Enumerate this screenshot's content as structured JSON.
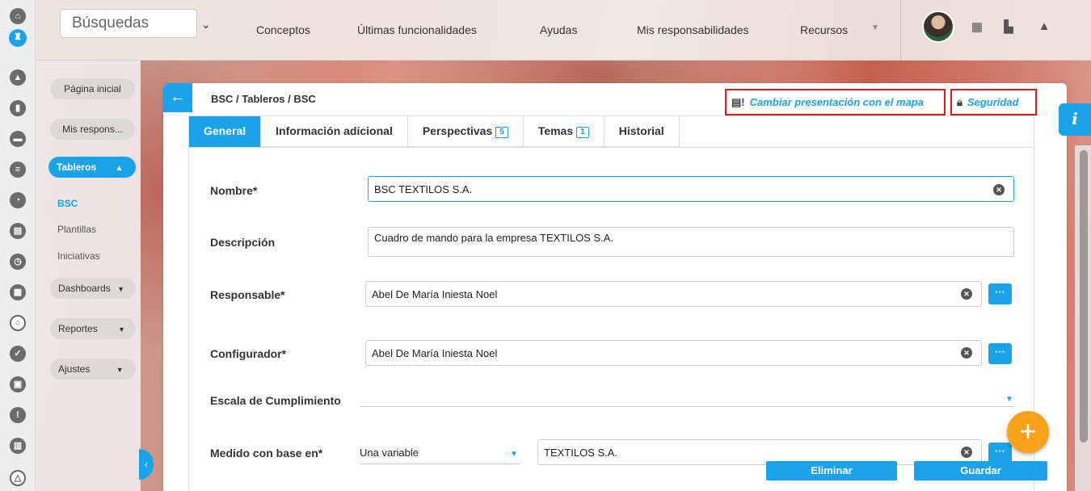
{
  "rail": {
    "icons": [
      "home-icon",
      "tower-icon",
      "user-up-icon",
      "chart-icon",
      "presentation-icon",
      "list-icon",
      "pie-icon",
      "book-icon",
      "clock-icon",
      "document-icon",
      "circle-dash-icon",
      "check-icon",
      "briefcase-icon",
      "warning-icon",
      "calendar-icon",
      "network-icon"
    ]
  },
  "topbar": {
    "search_label": "Búsquedas",
    "nav": [
      "Conceptos",
      "Últimas funcionalidades",
      "Ayudas",
      "Mis responsabilidades",
      "Recursos"
    ]
  },
  "sidebar": {
    "home": "Página inicial",
    "mine": "Mis respons...",
    "boards": "Tableros",
    "bsc": "BSC",
    "templates": "Plantillas",
    "initiatives": "Iniciativas",
    "dashboards": "Dashboards",
    "reports": "Reportes",
    "settings": "Ajustes"
  },
  "header": {
    "breadcrumb": "BSC / Tableros / BSC",
    "map_action": "Cambiar presentación con el mapa",
    "security_action": "Seguridad"
  },
  "tabs": {
    "general": "General",
    "extra": "Información adicional",
    "perspectives": "Perspectivas",
    "perspectives_count": "5",
    "themes": "Temas",
    "themes_count": "1",
    "history": "Historial"
  },
  "form": {
    "name_label": "Nombre*",
    "name_value": "BSC TEXTILOS S.A.",
    "desc_label": "Descripción",
    "desc_value": "Cuadro de mando para la empresa TEXTILOS S.A.",
    "owner_label": "Responsable*",
    "owner_value": "Abel De María Iniesta Noel",
    "config_label": "Configurador*",
    "config_value": "Abel De María Iniesta Noel",
    "scale_label": "Escala de Cumplimiento",
    "scale_value": "",
    "based_label": "Medido con base en*",
    "based_select": "Una variable",
    "based_value": "TEXTILOS S.A."
  },
  "buttons": {
    "more": "···",
    "delete": "Eliminar",
    "save": "Guardar"
  }
}
